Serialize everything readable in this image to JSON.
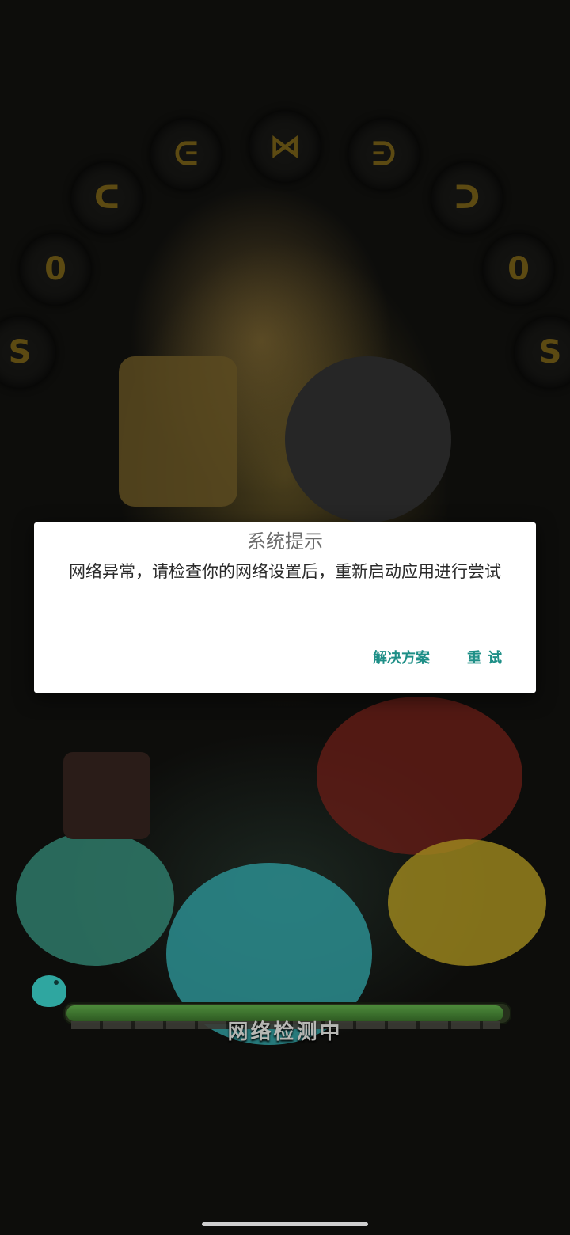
{
  "dialog": {
    "title": "系统提示",
    "message": "网络异常，请检查你的网络设置后，重新启动应用进行尝试",
    "solution_button": "解决方案",
    "retry_button": "重试"
  },
  "loading": {
    "status_text": "网络检测中",
    "progress_fraction": 0.99
  },
  "colors": {
    "accent": "#1e8f87",
    "dialog_bg": "#ffffff",
    "title_text": "#6d6d6d",
    "message_text": "#2b2b2b",
    "progress": "#4c8a3a"
  },
  "icons": {
    "mascot": "teal-slime-mascot-icon"
  }
}
